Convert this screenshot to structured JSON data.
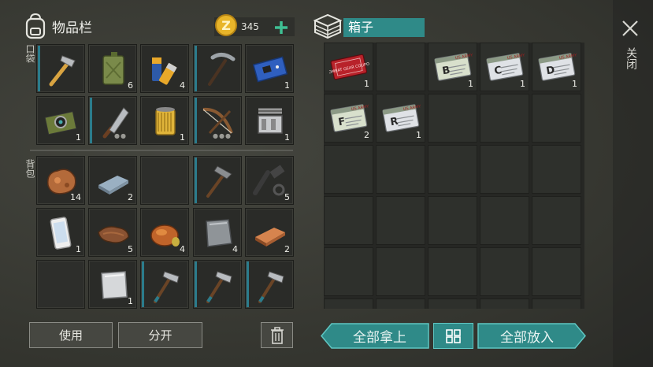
{
  "inventory": {
    "title": "物品栏",
    "coins": "345",
    "pocket_label": "口袋",
    "backpack_label": "背包",
    "pocket_slots": [
      {
        "item": "hammer",
        "count": "",
        "bar": true
      },
      {
        "item": "jerrycan",
        "count": "6",
        "bar": false
      },
      {
        "item": "batteries",
        "count": "4",
        "bar": false
      },
      {
        "item": "pickaxe",
        "count": "",
        "bar": true
      },
      {
        "item": "circuit-board",
        "count": "1",
        "bar": false
      },
      {
        "item": "camera-module",
        "count": "1",
        "bar": false
      },
      {
        "item": "cleaver",
        "count": "",
        "bar": true,
        "dots": "●●"
      },
      {
        "item": "oil-filter",
        "count": "1",
        "bar": false
      },
      {
        "item": "crossbow",
        "count": "",
        "bar": true,
        "dots": "●●●"
      },
      {
        "item": "engine-block",
        "count": "1",
        "bar": false
      }
    ],
    "backpack_slots": [
      {
        "item": "copper-ore",
        "count": "14",
        "bar": false
      },
      {
        "item": "iron-ingot",
        "count": "2",
        "bar": false
      },
      {
        "item": "",
        "count": "",
        "bar": false
      },
      {
        "item": "stone-pickaxe",
        "count": "",
        "bar": true
      },
      {
        "item": "rifle-parts",
        "count": "5",
        "bar": false
      },
      {
        "item": "smartphone",
        "count": "1",
        "bar": false
      },
      {
        "item": "leather",
        "count": "5",
        "bar": false
      },
      {
        "item": "roast-chicken",
        "count": "4",
        "bar": false
      },
      {
        "item": "iron-plate",
        "count": "4",
        "bar": false
      },
      {
        "item": "copper-ingot",
        "count": "2",
        "bar": false
      },
      {
        "item": "",
        "count": "",
        "bar": false
      },
      {
        "item": "aluminum-sheet",
        "count": "1",
        "bar": false
      },
      {
        "item": "hatchet",
        "count": "",
        "bar": true
      },
      {
        "item": "hatchet",
        "count": "",
        "bar": true
      },
      {
        "item": "hatchet",
        "count": "",
        "bar": true
      }
    ],
    "use_label": "使用",
    "split_label": "分开"
  },
  "box": {
    "title": "箱子",
    "slots": [
      {
        "item": "combat-gear-coupon",
        "count": "1",
        "letter": "",
        "coupon_text": "COMBAT GEAR COUPON"
      },
      {
        "item": "",
        "count": ""
      },
      {
        "item": "army-card",
        "count": "1",
        "letter": "B",
        "card_text": "US ARMY"
      },
      {
        "item": "army-card",
        "count": "1",
        "letter": "C",
        "card_text": "US ARMY"
      },
      {
        "item": "army-card",
        "count": "1",
        "letter": "D",
        "card_text": "US ARMY"
      },
      {
        "item": "army-card",
        "count": "2",
        "letter": "F",
        "card_text": "US ARMY"
      },
      {
        "item": "army-card",
        "count": "1",
        "letter": "R",
        "card_text": "US ARMY"
      }
    ],
    "take_all_label": "全部拿上",
    "put_all_label": "全部放入"
  },
  "close_label": "关闭",
  "colors": {
    "accent_teal": "#2f8a88",
    "bar_teal": "#2b7c8c",
    "coin_gold": "#e8b52a",
    "plus_green": "#3fbf93"
  }
}
